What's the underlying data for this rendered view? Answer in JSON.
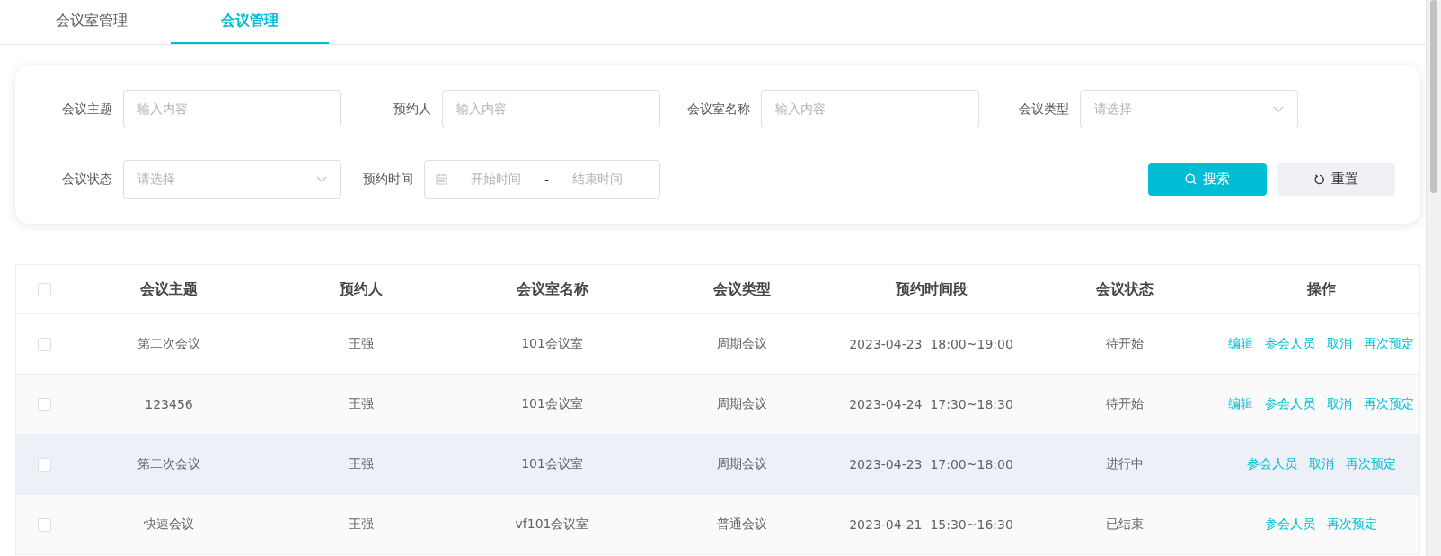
{
  "tabs": [
    {
      "label": "会议室管理",
      "selected": false
    },
    {
      "label": "会议管理",
      "selected": true
    }
  ],
  "filters": {
    "fields": [
      {
        "label": "会议主题",
        "kind": "input",
        "placeholder": "输入内容"
      },
      {
        "label": "预约人",
        "kind": "input",
        "placeholder": "输入内容"
      },
      {
        "label": "会议室名称",
        "kind": "input",
        "placeholder": "输入内容"
      },
      {
        "label": "会议类型",
        "kind": "select",
        "placeholder": "请选择"
      },
      {
        "label": "会议状态",
        "kind": "select",
        "placeholder": "请选择"
      },
      {
        "label": "预约时间",
        "kind": "daterange",
        "start_placeholder": "开始时间",
        "separator": "-",
        "end_placeholder": "结束时间"
      }
    ],
    "buttons": [
      {
        "label": "搜索",
        "kind": "primary"
      },
      {
        "label": "重置",
        "kind": "default"
      }
    ]
  },
  "table": {
    "select_all_checked": false,
    "columns": [
      "会议主题",
      "预约人",
      "会议室名称",
      "会议类型",
      "预约时间段",
      "会议状态",
      "操作"
    ],
    "rows": [
      {
        "checked": false,
        "highlighted": false,
        "cells": [
          "第二次会议",
          "王强",
          "101会议室",
          "周期会议",
          "2023-04-23  18:00~19:00",
          "待开始"
        ],
        "actions": [
          "编辑",
          "参会人员",
          "取消",
          "再次预定"
        ]
      },
      {
        "checked": false,
        "highlighted": false,
        "cells": [
          "123456",
          "王强",
          "101会议室",
          "周期会议",
          "2023-04-24  17:30~18:30",
          "待开始"
        ],
        "actions": [
          "编辑",
          "参会人员",
          "取消",
          "再次预定"
        ]
      },
      {
        "checked": false,
        "highlighted": true,
        "cells": [
          "第二次会议",
          "王强",
          "101会议室",
          "周期会议",
          "2023-04-23  17:00~18:00",
          "进行中"
        ],
        "actions": [
          "参会人员",
          "取消",
          "再次预定"
        ]
      },
      {
        "checked": false,
        "highlighted": false,
        "cells": [
          "快速会议",
          "王强",
          "vf101会议室",
          "普通会议",
          "2023-04-21  15:30~16:30",
          "已结束"
        ],
        "actions": [
          "参会人员",
          "再次预定"
        ]
      }
    ]
  }
}
